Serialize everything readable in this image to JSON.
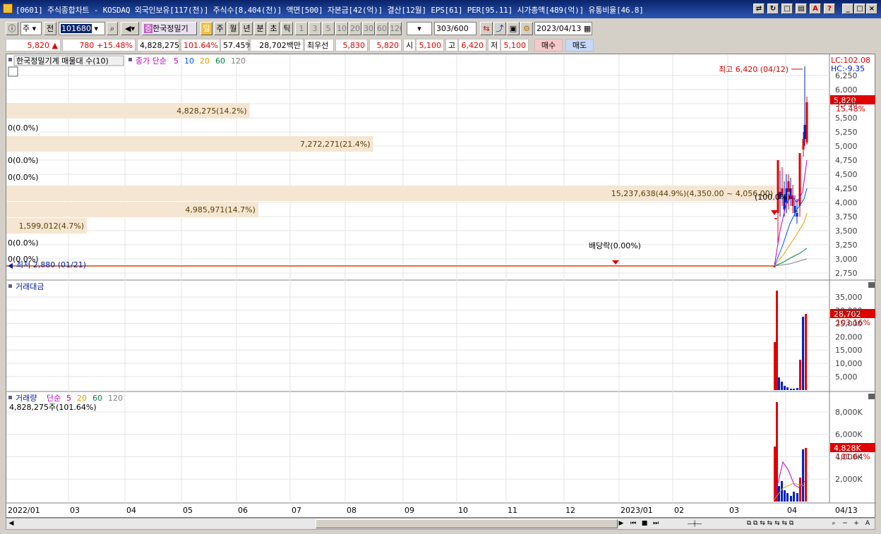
{
  "window": {
    "title": "[0601] 주식종합차트 - KOSDAQ 외국인보유[117(천)] 주식수[8,404(천)] 액면[500] 자본금[42(억)] 결산[12월] EPS[61] PER[95.11] 시가총액[489(억)] 유통비율[46.8]"
  },
  "toolbar": {
    "market_select": "주",
    "prev_label": "전",
    "code": "101680",
    "stock_name": "한국정밀기",
    "period_buttons": [
      "일",
      "주",
      "월",
      "년",
      "분",
      "초",
      "틱"
    ],
    "interval_buttons": [
      "1",
      "3",
      "5",
      "10",
      "20",
      "30",
      "60",
      "120"
    ],
    "count": "303",
    "count_total": "/600",
    "date": "2023/04/13"
  },
  "quote": {
    "price": "5,820",
    "arrow": "▲",
    "change": "780",
    "change_pct": "+15.48%",
    "volume": "4,828,275",
    "vol_ratio": "101.64%",
    "rate": "57.45%",
    "amount": "28,702백만",
    "pref_label": "최우선",
    "ask": "5,830",
    "bid": "5,820",
    "open_label": "시",
    "open": "5,100",
    "high_label": "고",
    "high": "6,420",
    "low_label": "저",
    "low": "5,100",
    "buy_label": "매수",
    "sell_label": "매도"
  },
  "price_panel": {
    "title": "한국정밀기계 매물대 수(10)",
    "ma_label": "종가 단순",
    "ma_periods": [
      "5",
      "10",
      "20",
      "60",
      "120"
    ],
    "high_note": "최고 6,420 (04/12)",
    "low_note": "최저 2,880 (01/21)",
    "dividend_note": "배당락(0.00%)",
    "marker_note": "(100.0%)",
    "lc": "LC:102.08",
    "hc": "HC:-9.35",
    "current_price": "5,820",
    "current_pct": "15.48%",
    "axis": [
      "6,250",
      "6,000",
      "5,750",
      "5,500",
      "5,250",
      "5,000",
      "4,750",
      "4,500",
      "4,250",
      "4,000",
      "3,750",
      "3,500",
      "3,250",
      "3,000",
      "2,750"
    ],
    "profile": [
      {
        "label": "0(0.0%)",
        "value": 0
      },
      {
        "label": "0(0.0%)",
        "value": 0
      },
      {
        "label": "1,599,012(4.7%)",
        "value": 4.7
      },
      {
        "label": "4,985,971(14.7%)",
        "value": 14.7
      },
      {
        "label": "15,237,638(44.9%)(4,350.00 ~ 4,056.00)",
        "value": 44.9
      },
      {
        "label": "0(0.0%)",
        "value": 0
      },
      {
        "label": "0(0.0%)",
        "value": 0
      },
      {
        "label": "7,272,271(21.4%)",
        "value": 21.4
      },
      {
        "label": "0(0.0%)",
        "value": 0
      },
      {
        "label": "4,828,275(14.2%)",
        "value": 14.2
      }
    ]
  },
  "amount_panel": {
    "title": "거래대금",
    "axis": [
      "35,000",
      "30,000",
      "25,000",
      "20,000",
      "15,000",
      "10,000",
      "5,000"
    ],
    "current": "28,702",
    "current_pct": "103.16%"
  },
  "volume_panel": {
    "title": "거래량",
    "ma_label": "단순",
    "ma_periods": [
      "5",
      "20",
      "60",
      "120"
    ],
    "info": "4,828,275주(101.64%)",
    "axis": [
      "8,000K",
      "6,000K",
      "4,000K",
      "2,000K"
    ],
    "current": "4,828K",
    "current_pct": "101.64%"
  },
  "x_axis": {
    "labels": [
      "2022/01",
      "03",
      "04",
      "05",
      "06",
      "07",
      "08",
      "09",
      "10",
      "11",
      "12",
      "2023/01",
      "02",
      "03",
      "04"
    ],
    "end_label": "04/13"
  },
  "colors": {
    "up": "#e00000",
    "down": "#0020c0",
    "profile": "#f5e6d3",
    "profile_text": "#5a4000",
    "ma5": "#c000c0",
    "ma10": "#0050ff",
    "ma20": "#e0a000",
    "ma60": "#008040",
    "ma120": "#808080"
  }
}
